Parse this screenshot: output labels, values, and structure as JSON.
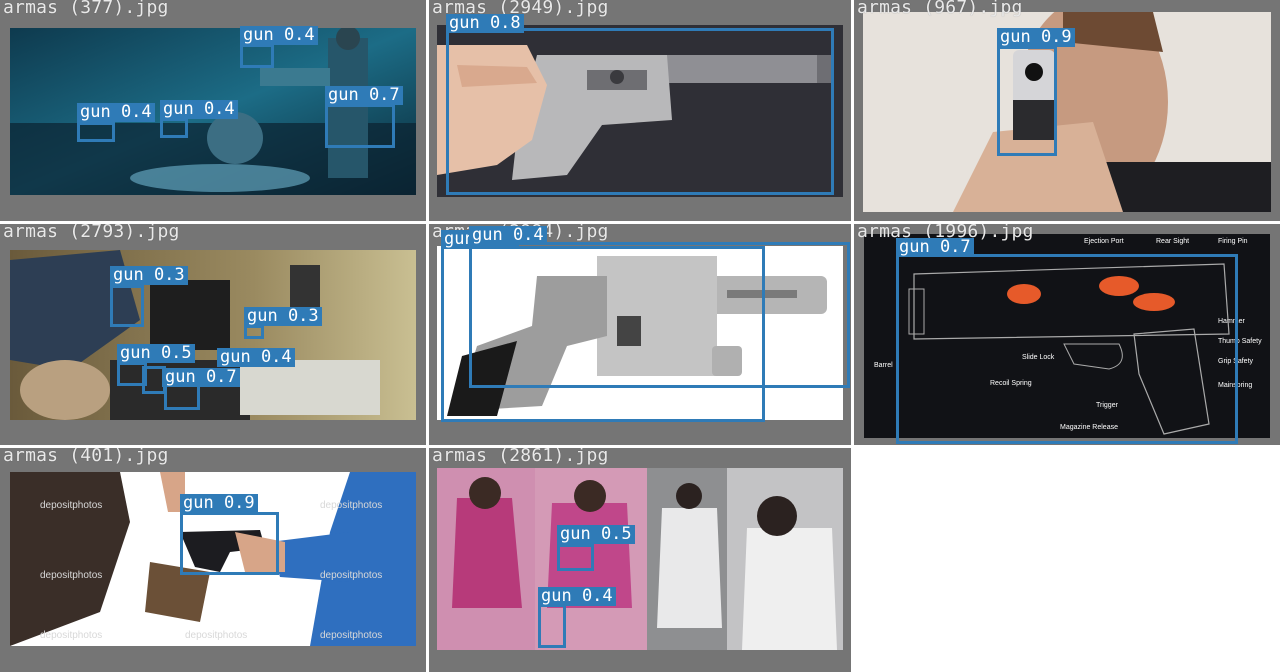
{
  "colors": {
    "tile_bg": "#757575",
    "box": "#2f7bb7",
    "label_text": "#ffffff",
    "filename_text": "#e9e9e9"
  },
  "tiles": [
    {
      "filename": "armas (377).jpg",
      "detections": [
        {
          "label": "gun 0.4"
        },
        {
          "label": "gun 0.7"
        },
        {
          "label": "gun 0.4"
        },
        {
          "label": "gun 0.4"
        }
      ]
    },
    {
      "filename": "armas (2949).jpg",
      "detections": [
        {
          "label": "gun 0.8"
        }
      ]
    },
    {
      "filename": "armas (967).jpg",
      "detections": [
        {
          "label": "gun 0.9"
        }
      ]
    },
    {
      "filename": "armas (2793).jpg",
      "detections": [
        {
          "label": "gun 0.3"
        },
        {
          "label": "gun 0.3"
        },
        {
          "label": "gun 0.5"
        },
        {
          "label": "gun 0.4"
        },
        {
          "label": "gun 0.7"
        }
      ]
    },
    {
      "filename": "armas (2984).jpg",
      "detections": [
        {
          "label": "gun 0.4"
        },
        {
          "label": "gun 0.4"
        }
      ]
    },
    {
      "filename": "armas (1996).jpg",
      "detections": [
        {
          "label": "gun 0.7"
        }
      ],
      "diagram_labels": [
        "Ejection Port",
        "Rear Sight",
        "Firing Pin",
        "Hammer",
        "Thumb Safety",
        "Grip Safety",
        "Mainspring",
        "Slide Lock",
        "Barrel",
        "Recoil Spring",
        "Trigger",
        "Magazine Release"
      ]
    },
    {
      "filename": "armas (401).jpg",
      "detections": [
        {
          "label": "gun 0.9"
        }
      ],
      "watermark": "depositphotos"
    },
    {
      "filename": "armas (2861).jpg",
      "detections": [
        {
          "label": "gun 0.5"
        },
        {
          "label": "gun 0.4"
        }
      ]
    }
  ]
}
